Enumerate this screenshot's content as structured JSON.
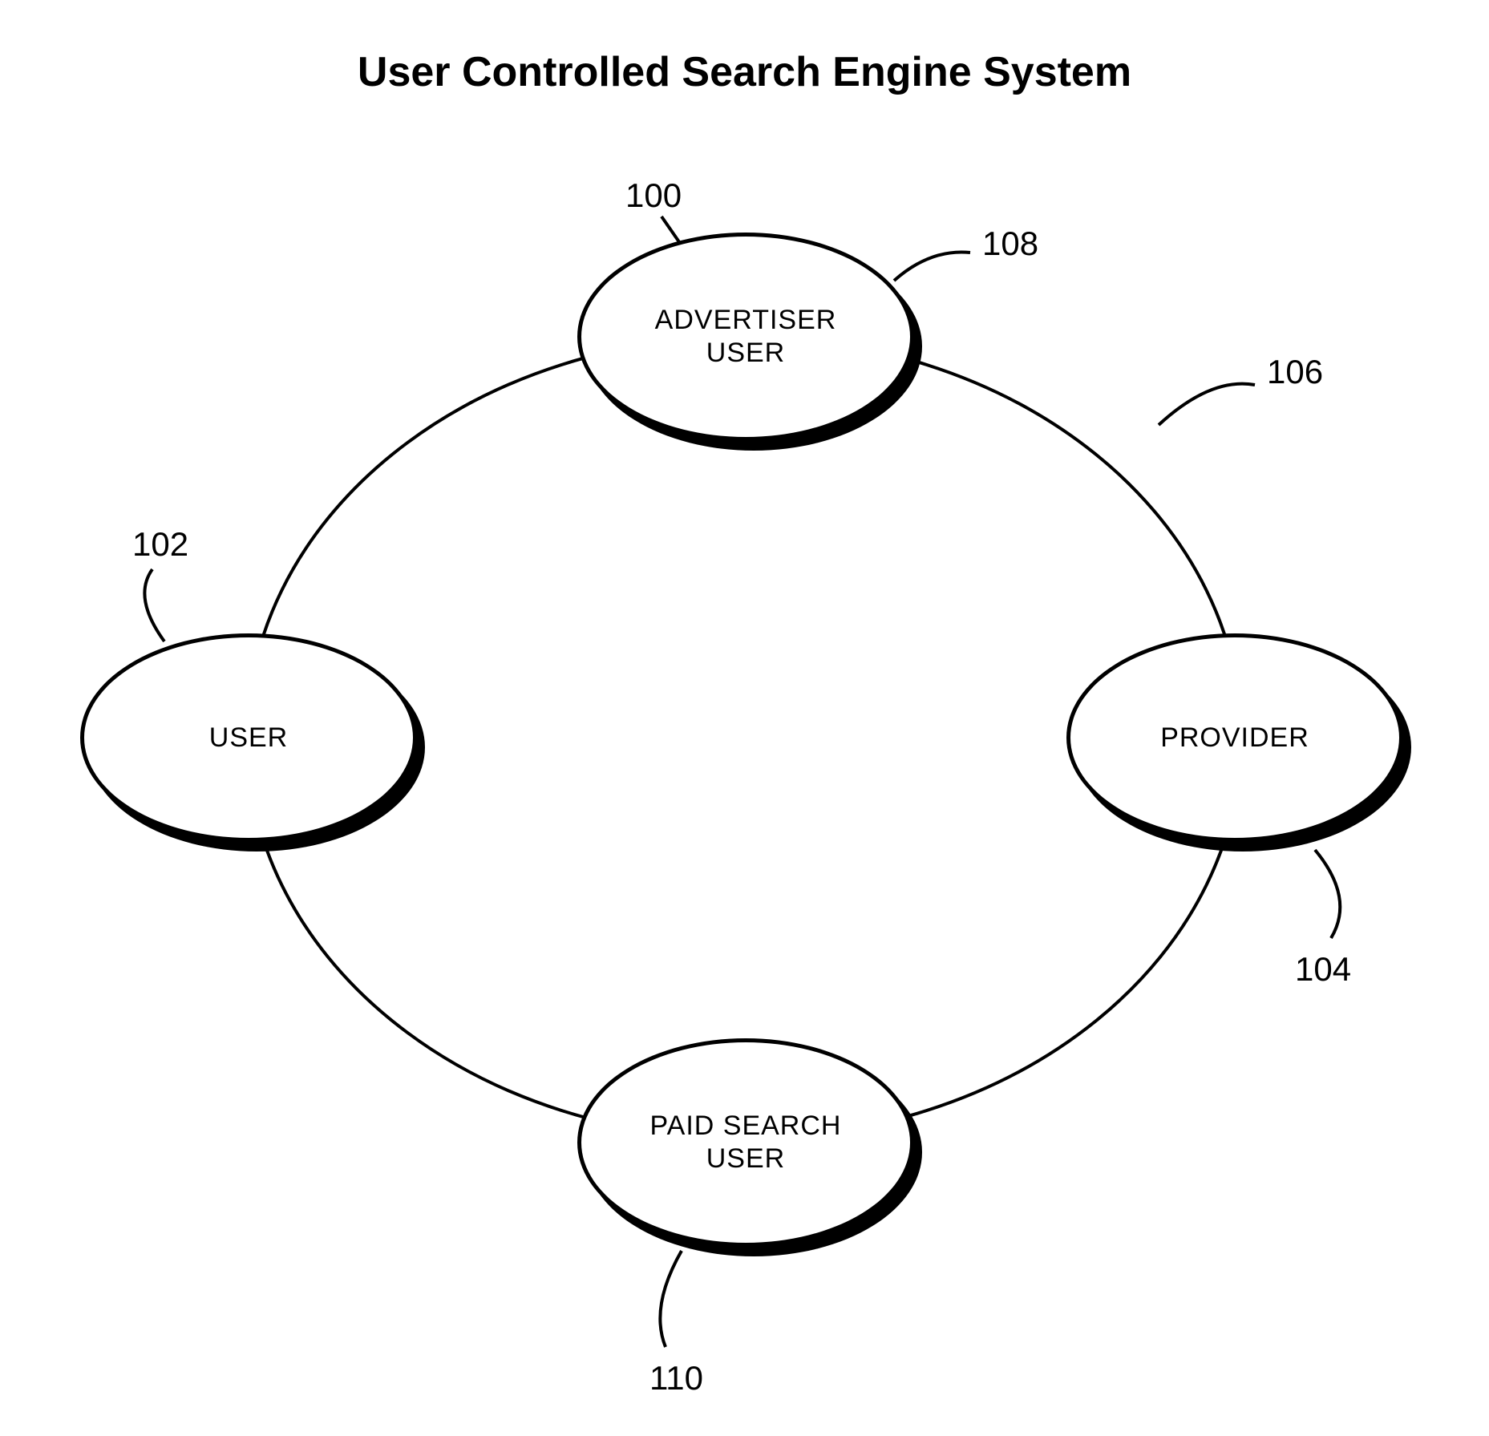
{
  "title": "User Controlled Search Engine System",
  "nodes": {
    "advertiser": {
      "label": "ADVERTISER\nUSER",
      "ref": "108"
    },
    "user": {
      "label": "USER",
      "ref": "102"
    },
    "provider": {
      "label": "PROVIDER",
      "ref": "104"
    },
    "paid_search": {
      "label": "PAID SEARCH\nUSER",
      "ref": "110"
    }
  },
  "refs": {
    "system": "100",
    "ring": "106"
  }
}
